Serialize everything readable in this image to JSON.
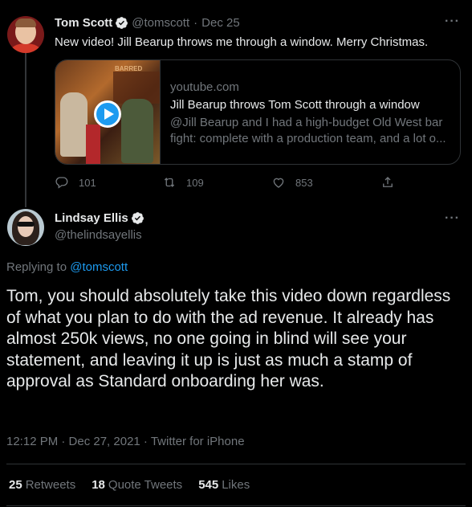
{
  "tweet1": {
    "name": "Tom Scott",
    "handle": "@tomscott",
    "separator": "·",
    "date": "Dec 25",
    "more": "···",
    "text": "New video! Jill Bearup throws me through a window. Merry Christmas.",
    "card": {
      "thumb_sign": "BARRED",
      "domain": "youtube.com",
      "title": "Jill Bearup throws Tom Scott through a window",
      "description": "@Jill Bearup and I had a high-budget Old West bar",
      "description2": "fight: complete with a production team, and a lot o..."
    },
    "actions": {
      "replies": "101",
      "retweets": "109",
      "likes": "853"
    }
  },
  "tweet2": {
    "name": "Lindsay Ellis",
    "handle": "@thelindsayellis",
    "more": "···",
    "replying_prefix": "Replying to",
    "replying_to": "@tomscott",
    "text": "Tom, you should absolutely take this video down regardless of what you plan to do with the ad revenue. It already has almost 250k views, no one going in blind will see your statement, and leaving it up is just as much a stamp of approval as Standard onboarding her was.",
    "timestamp": "12:12 PM · Dec 27, 2021 · Twitter for iPhone",
    "stats": {
      "retweets_count": "25",
      "retweets_label": "Retweets",
      "quotes_count": "18",
      "quotes_label": "Quote Tweets",
      "likes_count": "545",
      "likes_label": "Likes"
    }
  },
  "colors": {
    "background": "#000000",
    "text": "#e7e9ea",
    "muted": "#71767b",
    "accent": "#1d9bf0",
    "border": "#2f3336"
  }
}
